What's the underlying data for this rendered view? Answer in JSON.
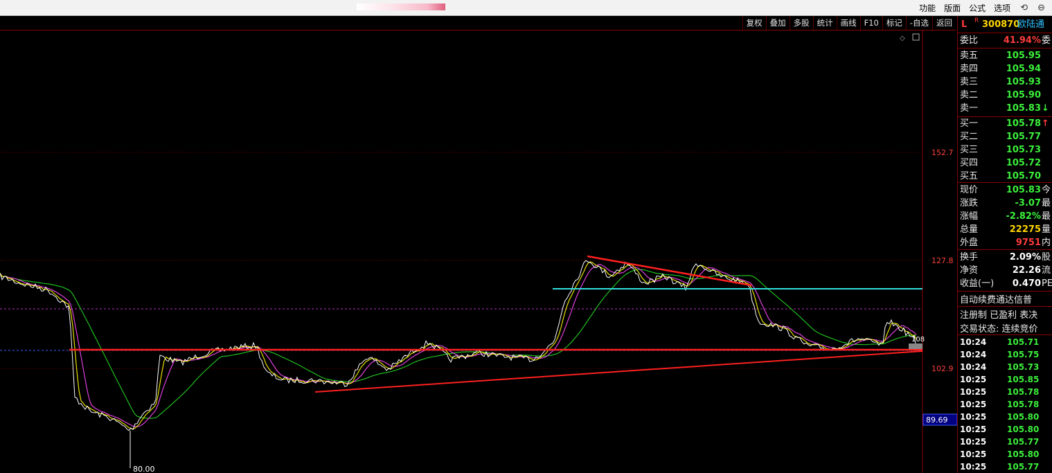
{
  "menubar": {
    "items": [
      "功能",
      "版面",
      "公式",
      "选项"
    ],
    "icons": [
      "refresh-icon",
      "minimize-icon"
    ]
  },
  "toolbar": {
    "buttons": [
      "复权",
      "叠加",
      "多股",
      "统计",
      "画线",
      "F10",
      "标记",
      "-自选",
      "返回"
    ]
  },
  "chart": {
    "axis_labels": [
      "152.7",
      "127.8",
      "102.9"
    ],
    "crosshair_value": "89.69",
    "low_label": "80.00",
    "edge_label": "108",
    "colors": {
      "price": "#ffffff",
      "ma_yellow": "#e8e000",
      "ma_magenta": "#e040e0",
      "ma_green": "#20c020",
      "trend_red": "#ff2020",
      "support_cyan": "#30e0e0",
      "grid": "#8b0000"
    }
  },
  "stock": {
    "flag": "L",
    "r_mark": "R",
    "code": "300870",
    "name": "欧陆通"
  },
  "ratio": {
    "label": "委比",
    "value": "41.94%",
    "extra": "委"
  },
  "asks": [
    {
      "label": "卖五",
      "price": "105.95"
    },
    {
      "label": "卖四",
      "price": "105.94"
    },
    {
      "label": "卖三",
      "price": "105.93"
    },
    {
      "label": "卖二",
      "price": "105.90"
    },
    {
      "label": "卖一",
      "price": "105.83",
      "arrow": "↓"
    }
  ],
  "bids": [
    {
      "label": "买一",
      "price": "105.78",
      "arrow": "↑"
    },
    {
      "label": "买二",
      "price": "105.77"
    },
    {
      "label": "买三",
      "price": "105.73"
    },
    {
      "label": "买四",
      "price": "105.72"
    },
    {
      "label": "买五",
      "price": "105.70"
    }
  ],
  "quote": [
    {
      "label": "现价",
      "value": "105.83",
      "extra": "今",
      "color": "green"
    },
    {
      "label": "涨跌",
      "value": "-3.07",
      "extra": "最",
      "color": "green"
    },
    {
      "label": "涨幅",
      "value": "-2.82%",
      "extra": "最",
      "color": "green"
    },
    {
      "label": "总量",
      "value": "22275",
      "extra": "量",
      "color": "yellow"
    },
    {
      "label": "外盘",
      "value": "9751",
      "extra": "内",
      "color": "red"
    }
  ],
  "stats": [
    {
      "label": "换手",
      "value": "2.09%",
      "extra": "股"
    },
    {
      "label": "净资",
      "value": "22.26",
      "extra": "流"
    },
    {
      "label": "收益(一)",
      "value": "0.470",
      "extra": "PE"
    }
  ],
  "info": {
    "line1": "自动续费通达信普",
    "line2": "注册制 已盈利 表决",
    "line3": "交易状态: 连续竞价"
  },
  "ticks": [
    {
      "time": "10:24",
      "price": "105.71"
    },
    {
      "time": "10:24",
      "price": "105.75"
    },
    {
      "time": "10:24",
      "price": "105.73"
    },
    {
      "time": "10:25",
      "price": "105.85"
    },
    {
      "time": "10:25",
      "price": "105.78"
    },
    {
      "time": "10:25",
      "price": "105.78"
    },
    {
      "time": "10:25",
      "price": "105.80"
    },
    {
      "time": "10:25",
      "price": "105.80"
    },
    {
      "time": "10:25",
      "price": "105.77"
    },
    {
      "time": "10:25",
      "price": "105.80"
    },
    {
      "time": "10:25",
      "price": "105.77"
    }
  ]
}
